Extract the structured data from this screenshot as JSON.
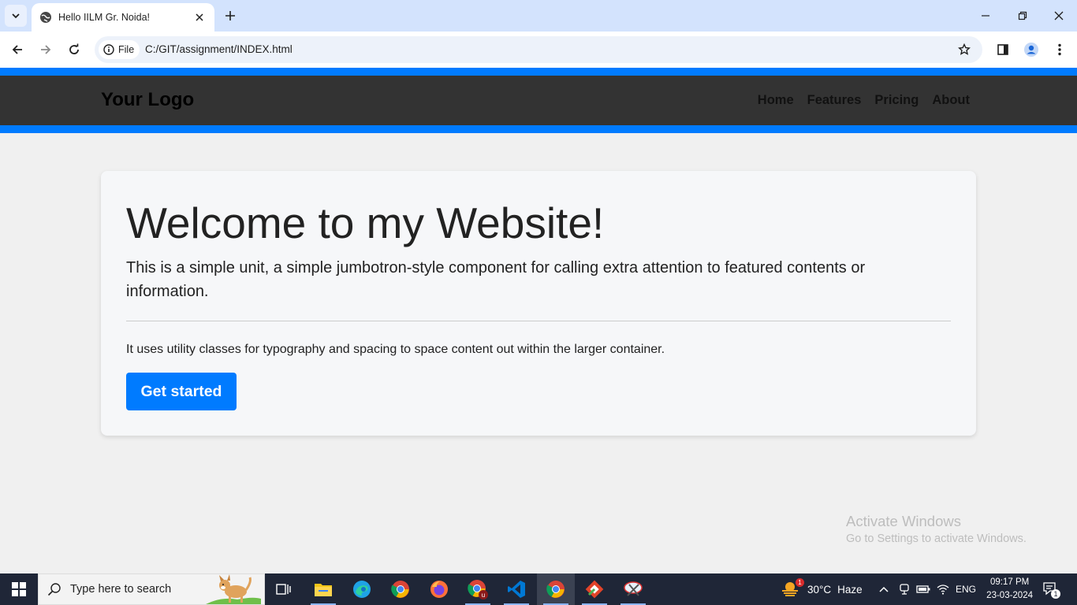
{
  "browser": {
    "tab_title": "Hello IILM Gr. Noida!",
    "chip_label": "File",
    "url": "C:/GIT/assignment/INDEX.html"
  },
  "site": {
    "logo": "Your Logo",
    "nav": [
      "Home",
      "Features",
      "Pricing",
      "About"
    ],
    "heading": "Welcome to my Website!",
    "lead": "This is a simple unit, a simple jumbotron-style component for calling extra attention to featured contents or information.",
    "sub": "It uses utility classes for typography and spacing to space content out within the larger container.",
    "cta": "Get started"
  },
  "watermark": {
    "line1": "Activate Windows",
    "line2": "Go to Settings to activate Windows."
  },
  "taskbar": {
    "search_placeholder": "Type here to search",
    "weather_temp": "30°C",
    "weather_desc": "Haze",
    "weather_badge": "1",
    "language": "ENG",
    "time": "09:17 PM",
    "date": "23-03-2024",
    "notification_count": "1"
  },
  "colors": {
    "accent": "#007bff",
    "header_bg": "#333333",
    "page_bg": "#f0f0f0",
    "tabstrip": "#d3e3fd",
    "taskbar": "#1f2637"
  }
}
